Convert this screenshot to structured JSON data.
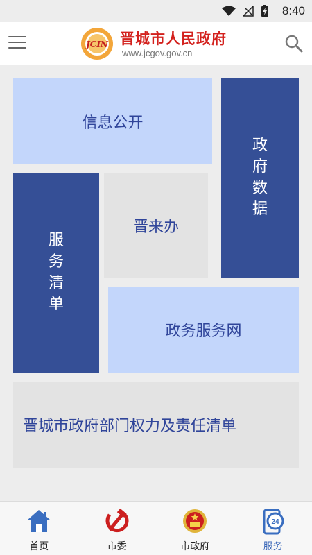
{
  "status_bar": {
    "time": "8:40"
  },
  "header": {
    "logo_text": "JCIN",
    "title": "晋城市人民政府",
    "url": "www.jcgov.gov.cn"
  },
  "tiles": {
    "info_public": "信息公开",
    "gov_data": "政府数据",
    "service_list": "服务清单",
    "jin_lai_ban": "晋来办",
    "gov_service_net": "政务服务网",
    "power_list": "晋城市政府部门权力及责任清单"
  },
  "nav": {
    "home": "首页",
    "party": "市委",
    "government": "市政府",
    "service": "服务",
    "active": "service"
  },
  "colors": {
    "accent_dark": "#354f96",
    "accent_light": "#c3d6fb",
    "tile_gray": "#e3e3e3",
    "brand_red": "#d3211d",
    "active_nav": "#3a67b8"
  }
}
